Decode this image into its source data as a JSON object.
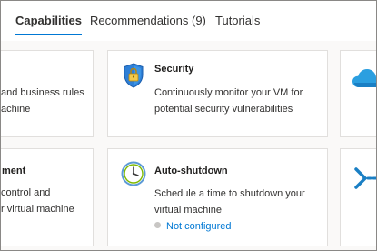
{
  "tabs": [
    {
      "label": "Capabilities",
      "active": true
    },
    {
      "label": "Recommendations (9)",
      "active": false
    },
    {
      "label": "Tutorials",
      "active": false
    }
  ],
  "cards": {
    "partial_left_top": {
      "lines": [
        "and business rules",
        "achine"
      ]
    },
    "security": {
      "title": "Security",
      "lines": [
        "Continuously monitor your VM for",
        "potential security vulnerabilities"
      ],
      "icon": "shield-icon"
    },
    "partial_left_bottom": {
      "title": "ment",
      "lines": [
        "control and",
        "r virtual machine"
      ]
    },
    "auto_shutdown": {
      "title": "Auto-shutdown",
      "lines": [
        "Schedule a time to shutdown your",
        "virtual machine"
      ],
      "status": "Not configured",
      "icon": "clock-icon"
    },
    "partial_right_top": {
      "icon": "cloud-icon"
    },
    "partial_right_bottom": {
      "icon": "connect-icon"
    }
  },
  "colors": {
    "accent": "#0078d4",
    "status_dot": "#c8c6c4"
  }
}
